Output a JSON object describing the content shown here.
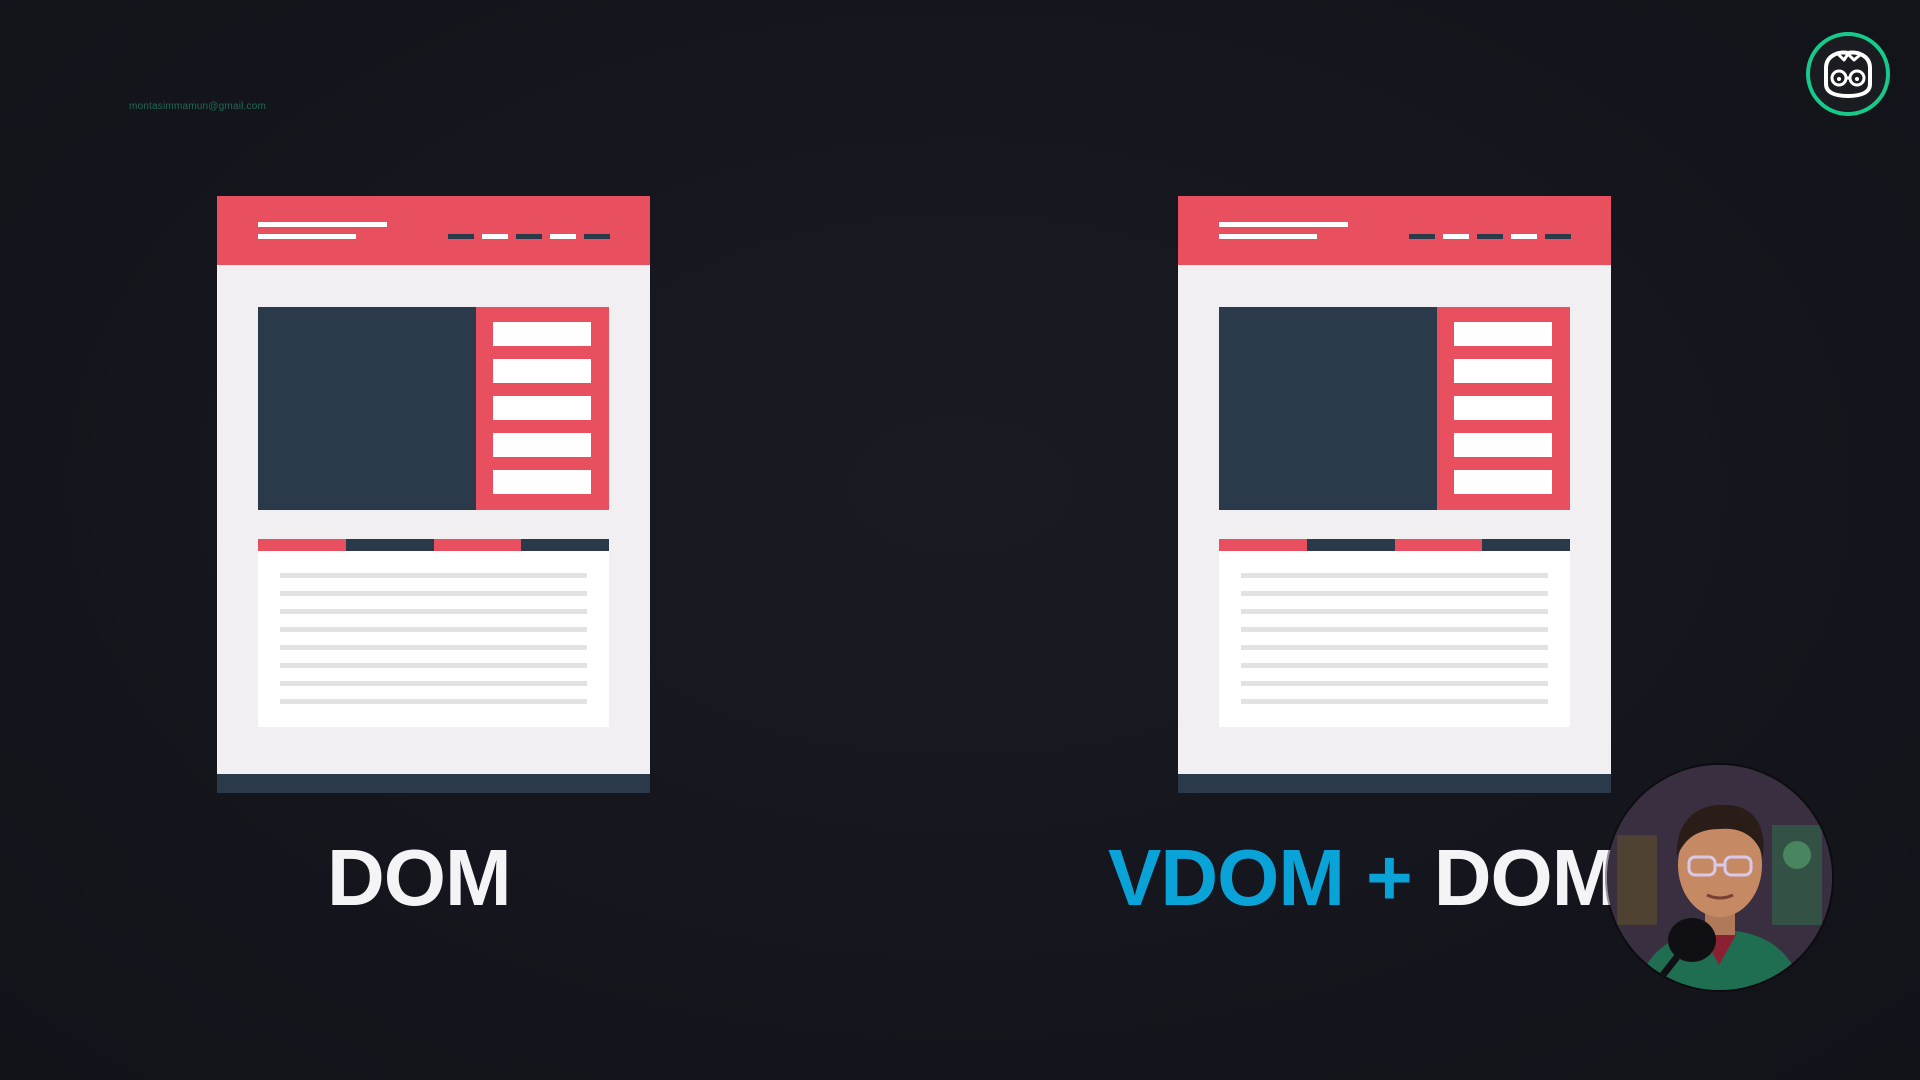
{
  "watermark": {
    "email": "montasimmamun@gmail.com"
  },
  "channel_logo": {
    "icon": "glasses-avatar-icon",
    "accent_color": "#17c98b"
  },
  "left_panel": {
    "label": "DOM"
  },
  "right_panel": {
    "label_vdom": "VDOM",
    "label_plus": "+",
    "label_dom": "DOM"
  },
  "colors": {
    "background": "#15151d",
    "wireframe_red": "#e8505f",
    "wireframe_dark": "#2b3a4b",
    "wireframe_page": "#f1eff1",
    "vdom_blue": "#0aa3d8",
    "label_white": "#f4f4f6"
  },
  "presenter": {
    "icon": "presenter-webcam"
  }
}
